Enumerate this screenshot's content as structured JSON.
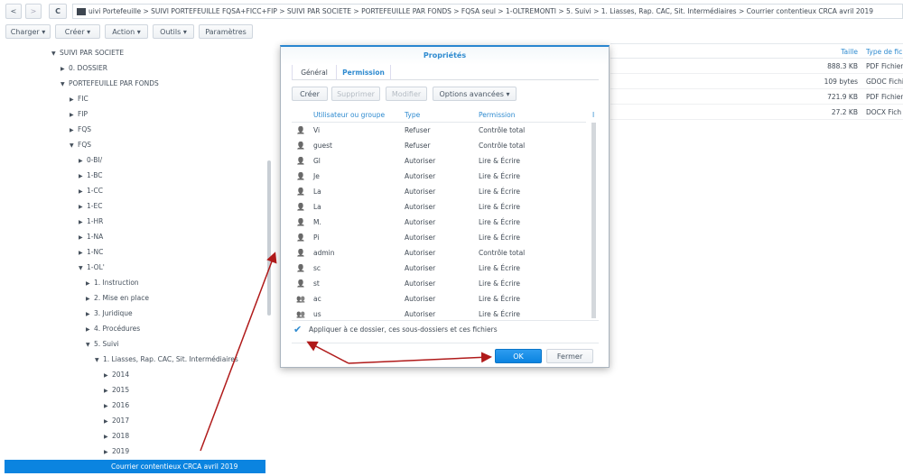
{
  "nav": {
    "back": "<",
    "forward": ">",
    "refresh": "C"
  },
  "breadcrumb": "uivi Portefeuille  >  SUIVI PORTEFEUILLE FQSA+FICC+FIP  >  SUIVI PAR SOCIETE  >  PORTEFEUILLE PAR FONDS  >  FQSA seul  >  1-OLTREMONTI  >  5. Suivi  >  1. Liasses, Rap. CAC, Sit. Intermédiaires  >  Courrier contentieux CRCA avril 2019",
  "toolbar": [
    "Charger ▾",
    "Créer ▾",
    "Action ▾",
    "Outils ▾",
    "Paramètres"
  ],
  "tree": [
    {
      "label": "SUIVI PAR SOCIETE",
      "caret": "▼",
      "lvl": 0
    },
    {
      "label": "0. DOSSIER",
      "caret": "▶",
      "lvl": 1
    },
    {
      "label": "PORTEFEUILLE PAR FONDS",
      "caret": "▼",
      "lvl": 1
    },
    {
      "label": "FIC",
      "caret": "▶",
      "lvl": 2
    },
    {
      "label": "FIP",
      "caret": "▶",
      "lvl": 2
    },
    {
      "label": "FQS",
      "caret": "▶",
      "lvl": 2
    },
    {
      "label": "FQS",
      "caret": "▼",
      "lvl": 2
    },
    {
      "label": "0-BI/",
      "caret": "▶",
      "lvl": 3
    },
    {
      "label": "1-BC",
      "caret": "▶",
      "lvl": 3
    },
    {
      "label": "1-CC",
      "caret": "▶",
      "lvl": 3
    },
    {
      "label": "1-EC",
      "caret": "▶",
      "lvl": 3
    },
    {
      "label": "1-HR",
      "caret": "▶",
      "lvl": 3
    },
    {
      "label": "1-NA",
      "caret": "▶",
      "lvl": 3
    },
    {
      "label": "1-NC",
      "caret": "▶",
      "lvl": 3
    },
    {
      "label": "1-OL'",
      "caret": "▼",
      "lvl": 3
    },
    {
      "label": "1. Instruction",
      "caret": "▶",
      "lvl": 4
    },
    {
      "label": "2. Mise en place",
      "caret": "▶",
      "lvl": 4
    },
    {
      "label": "3. Juridique",
      "caret": "▶",
      "lvl": 4
    },
    {
      "label": "4. Procédures",
      "caret": "▶",
      "lvl": 4
    },
    {
      "label": "5. Suivi",
      "caret": "▼",
      "lvl": 4
    },
    {
      "label": "1. Liasses, Rap. CAC, Sit. Intermédiaires",
      "caret": "▼",
      "lvl": 5
    },
    {
      "label": "2014",
      "caret": "▶",
      "lvl": 6
    },
    {
      "label": "2015",
      "caret": "▶",
      "lvl": 6
    },
    {
      "label": "2016",
      "caret": "▶",
      "lvl": 6
    },
    {
      "label": "2017",
      "caret": "▶",
      "lvl": 6
    },
    {
      "label": "2018",
      "caret": "▶",
      "lvl": 6
    },
    {
      "label": "2019",
      "caret": "▶",
      "lvl": 6
    }
  ],
  "selected_item": "Courrier contentieux CRCA avril 2019",
  "filelist": {
    "headers": {
      "size": "Taille",
      "type": "Type de fic"
    },
    "rows": [
      {
        "size": "888.3 KB",
        "type": "PDF Fichier"
      },
      {
        "size": "109 bytes",
        "type": "GDOC Fichi"
      },
      {
        "size": "721.9 KB",
        "type": "PDF Fichier"
      },
      {
        "size": "27.2 KB",
        "type": "DOCX Fich"
      }
    ]
  },
  "dialog": {
    "title": "Propriétés",
    "tabs": [
      "Général",
      "Permission"
    ],
    "buttons": {
      "create": "Créer",
      "delete": "Supprimer",
      "edit": "Modifier",
      "advanced": "Options avancées ▾"
    },
    "columns": {
      "user": "Utilisateur ou groupe",
      "type": "Type",
      "perm": "Permission",
      "extra": "I"
    },
    "rows": [
      {
        "user": "Vi",
        "type": "Refuser",
        "perm": "Contrôle total",
        "group": false
      },
      {
        "user": "guest",
        "type": "Refuser",
        "perm": "Contrôle total",
        "group": false
      },
      {
        "user": "Gl",
        "type": "Autoriser",
        "perm": "Lire & Écrire",
        "group": false
      },
      {
        "user": "Je",
        "type": "Autoriser",
        "perm": "Lire & Écrire",
        "group": false
      },
      {
        "user": "La",
        "type": "Autoriser",
        "perm": "Lire & Écrire",
        "group": false
      },
      {
        "user": "La",
        "type": "Autoriser",
        "perm": "Lire & Écrire",
        "group": false
      },
      {
        "user": "M.",
        "type": "Autoriser",
        "perm": "Lire & Écrire",
        "group": false
      },
      {
        "user": "Pi",
        "type": "Autoriser",
        "perm": "Lire & Écrire",
        "group": false
      },
      {
        "user": "admin",
        "type": "Autoriser",
        "perm": "Contrôle total",
        "group": false
      },
      {
        "user": "sc",
        "type": "Autoriser",
        "perm": "Lire & Écrire",
        "group": false
      },
      {
        "user": "st",
        "type": "Autoriser",
        "perm": "Lire & Écrire",
        "group": false
      },
      {
        "user": "ac",
        "type": "Autoriser",
        "perm": "Lire & Écrire",
        "group": true
      },
      {
        "user": "us",
        "type": "Autoriser",
        "perm": "Lire & Écrire",
        "group": true
      }
    ],
    "apply_label": "Appliquer à ce dossier, ces sous-dossiers et ces fichiers",
    "apply_checked": true,
    "ok": "OK",
    "close": "Fermer"
  },
  "colors": {
    "accent": "#0b84e0",
    "arrow": "#b01a1a"
  }
}
